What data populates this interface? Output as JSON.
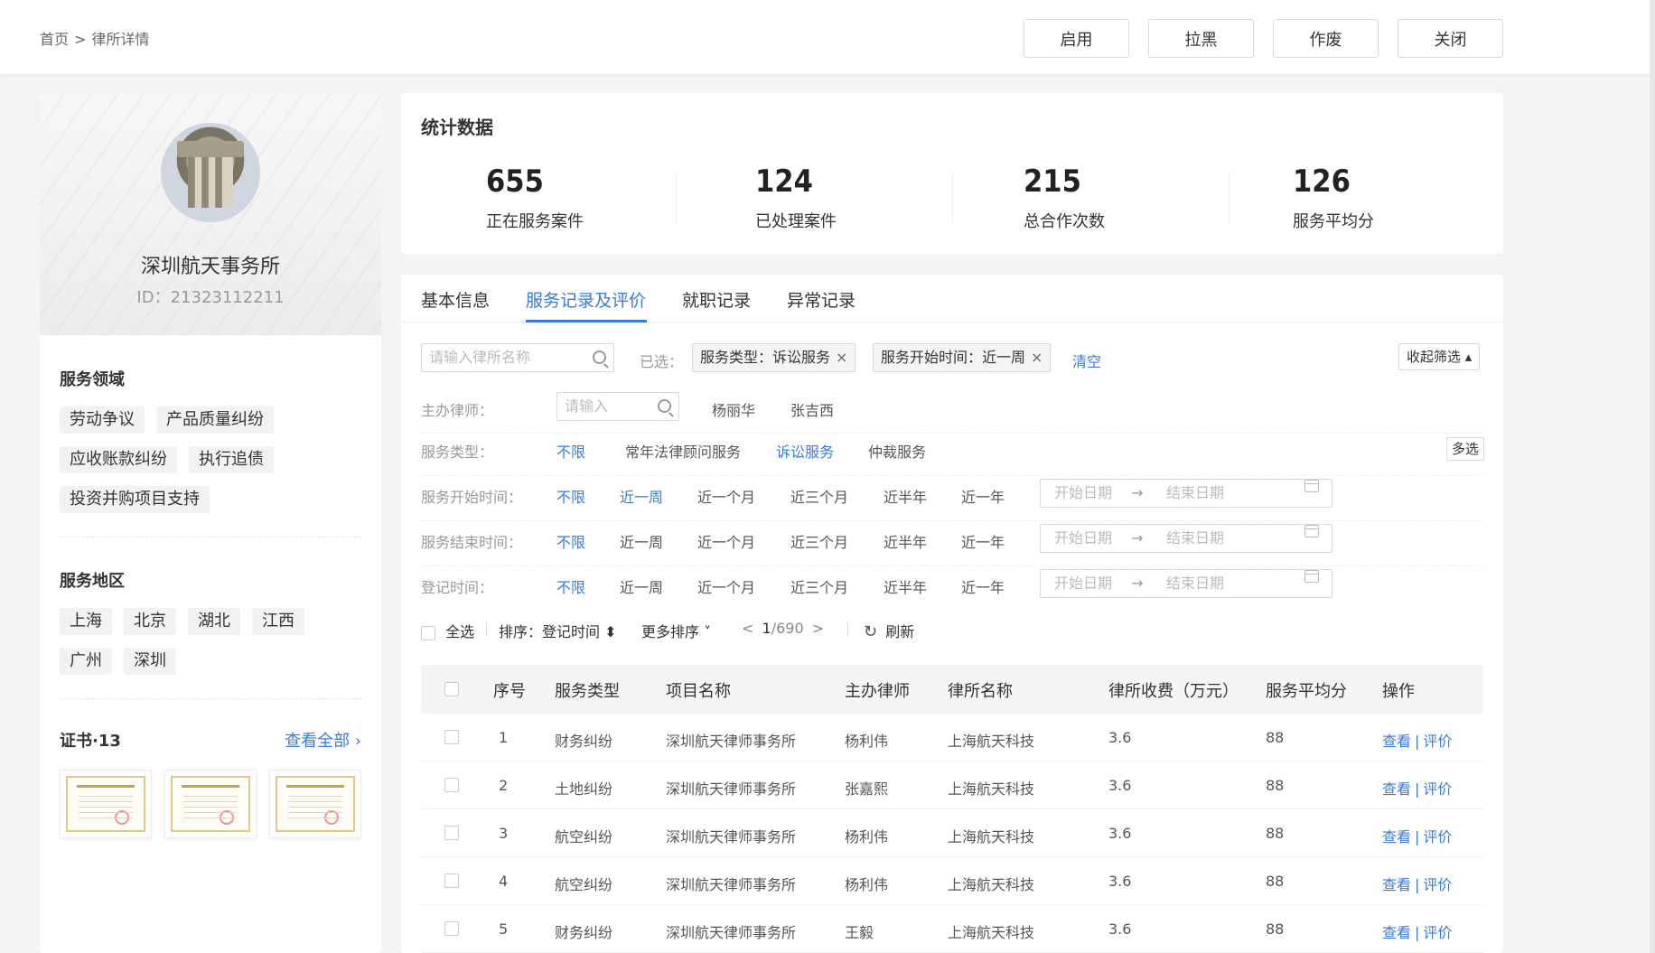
{
  "breadcrumb": {
    "home": "首页",
    "sep": ">",
    "current": "律所详情"
  },
  "top_actions": [
    "启用",
    "拉黑",
    "作废",
    "关闭"
  ],
  "profile": {
    "name": "深圳航天事务所",
    "id": "ID：21323112211"
  },
  "service_areas": {
    "title": "服务领域",
    "tags": [
      "劳动争议",
      "产品质量纠纷",
      "应收账款纠纷",
      "执行追债",
      "投资并购项目支持"
    ]
  },
  "service_regions": {
    "title": "服务地区",
    "tags": [
      "上海",
      "北京",
      "湖北",
      "江西",
      "广州",
      "深圳"
    ]
  },
  "certs": {
    "title": "证书·13",
    "view_all": "查看全部 ›"
  },
  "stats": {
    "title": "统计数据",
    "items": [
      {
        "value": "655",
        "label": "正在服务案件"
      },
      {
        "value": "124",
        "label": "已处理案件"
      },
      {
        "value": "215",
        "label": "总合作次数"
      },
      {
        "value": "126",
        "label": "服务平均分"
      }
    ]
  },
  "tabs": [
    "基本信息",
    "服务记录及评价",
    "就职记录",
    "异常记录"
  ],
  "filters": {
    "search_placeholder": "请输入律所名称",
    "selected_label": "已选：",
    "chips": [
      "服务类型：诉讼服务",
      "服务开始时间：近一周"
    ],
    "chip_close": "×",
    "clear": "清空",
    "collapse": "收起筛选 ▴",
    "lawyer_label": "主办律师：",
    "lawyer_placeholder": "请输入",
    "lawyers": [
      "杨丽华",
      "张吉西"
    ],
    "type_label": "服务类型：",
    "types": [
      "不限",
      "常年法律顾问服务",
      "诉讼服务",
      "仲裁服务"
    ],
    "multi": "多选",
    "start_label": "服务开始时间：",
    "end_label": "服务结束时间：",
    "reg_label": "登记时间：",
    "periods": [
      "不限",
      "近一周",
      "近一个月",
      "近三个月",
      "近半年",
      "近一年"
    ],
    "date_start": "开始日期",
    "date_arrow": "→",
    "date_end": "结束日期"
  },
  "toolbar": {
    "select_all": "全选",
    "sort": "排序：登记时间 ⬍",
    "more_sort": "更多排序 ˅",
    "pager_prev": "<",
    "pager_current": "1",
    "pager_total": "/690",
    "pager_next": ">",
    "refresh": "刷新"
  },
  "table": {
    "headers": [
      "序号",
      "服务类型",
      "项目名称",
      "主办律师",
      "律所名称",
      "律所收费（万元）",
      "服务平均分",
      "操作"
    ],
    "rows": [
      [
        "1",
        "财务纠纷",
        "深圳航天律师事务所",
        "杨利伟",
        "上海航天科技",
        "3.6",
        "88"
      ],
      [
        "2",
        "土地纠纷",
        "深圳航天律师事务所",
        "张嘉熙",
        "上海航天科技",
        "3.6",
        "88"
      ],
      [
        "3",
        "航空纠纷",
        "深圳航天律师事务所",
        "杨利伟",
        "上海航天科技",
        "3.6",
        "88"
      ],
      [
        "4",
        "航空纠纷",
        "深圳航天律师事务所",
        "杨利伟",
        "上海航天科技",
        "3.6",
        "88"
      ],
      [
        "5",
        "财务纠纷",
        "深圳航天律师事务所",
        "王毅",
        "上海航天科技",
        "3.6",
        "88"
      ]
    ],
    "op_view": "查看",
    "op_sep": "|",
    "op_rate": "评价"
  },
  "colors": {
    "accent": "#3a7bd5"
  }
}
